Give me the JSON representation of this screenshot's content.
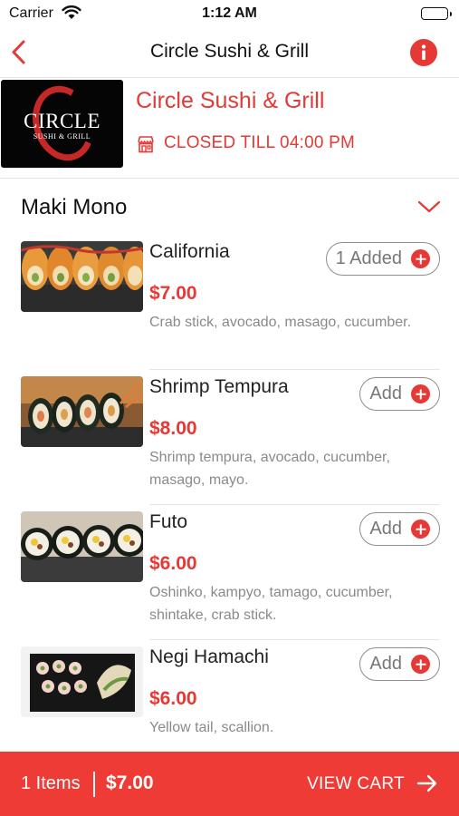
{
  "status_bar": {
    "carrier": "Carrier",
    "time": "1:12 AM",
    "battery_level": 1.0
  },
  "nav": {
    "title": "Circle Sushi & Grill",
    "back_icon": "chevron-left-icon",
    "info_icon": "info-icon"
  },
  "restaurant": {
    "name": "Circle Sushi & Grill",
    "logo_text": "CIRCLE",
    "logo_subtext": "SUSHI & GRILL",
    "status_icon": "store-icon",
    "status": "CLOSED TILL 04:00 PM"
  },
  "category": {
    "title": "Maki Mono",
    "chevron_icon": "chevron-down-icon"
  },
  "items": [
    {
      "name": "California",
      "price": "$7.00",
      "description": "Crab stick, avocado, masago, cucumber.",
      "button_label": "1 Added"
    },
    {
      "name": "Shrimp Tempura",
      "price": "$8.00",
      "description": "Shrimp tempura, avocado, cucumber, masago, mayo.",
      "button_label": "Add"
    },
    {
      "name": "Futo",
      "price": "$6.00",
      "description": "Oshinko, kampyo, tamago, cucumber, shintake, crab stick.",
      "button_label": "Add"
    },
    {
      "name": "Negi Hamachi",
      "price": "$6.00",
      "description": "Yellow tail, scallion.",
      "button_label": "Add"
    }
  ],
  "cart": {
    "count_label": "1 Items",
    "total": "$7.00",
    "view_label": "VIEW CART"
  },
  "colors": {
    "accent": "#e53935",
    "cart_bar": "#ee3b35",
    "description_text": "#8a8a8a"
  }
}
